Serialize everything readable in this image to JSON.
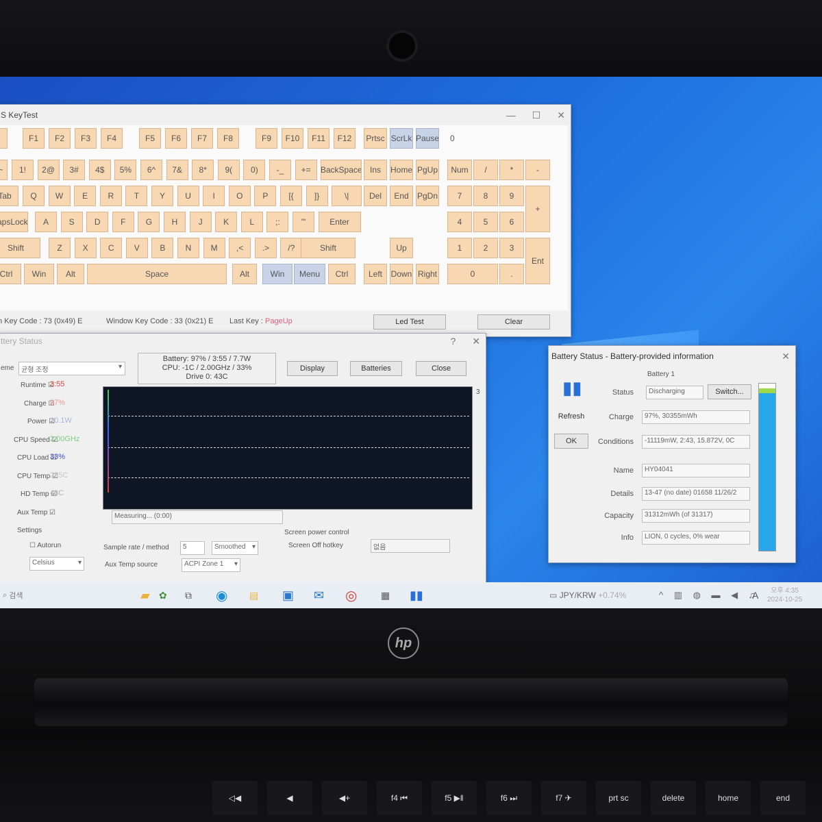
{
  "keytest": {
    "title": "S KeyTest",
    "counter": "0",
    "fn_row": [
      "F1",
      "F2",
      "F3",
      "F4",
      "F5",
      "F6",
      "F7",
      "F8",
      "F9",
      "F10",
      "F11",
      "F12"
    ],
    "sys_keys": [
      "Prtsc",
      "ScrLk",
      "Pause"
    ],
    "num_row": [
      "1!",
      "2@",
      "3#",
      "4$",
      "5%",
      "6^",
      "7&",
      "8*",
      "9(",
      "0)",
      "-_",
      "+=",
      "BackSpace"
    ],
    "q_row": [
      "Tab",
      "Q",
      "W",
      "E",
      "R",
      "T",
      "Y",
      "U",
      "I",
      "O",
      "P",
      "[{",
      "]}",
      "\\|"
    ],
    "a_row": [
      "CapsLock",
      "A",
      "S",
      "D",
      "F",
      "G",
      "H",
      "J",
      "K",
      "L",
      ";:",
      "'\"",
      "Enter"
    ],
    "z_row": [
      "Shift",
      "Z",
      "X",
      "C",
      "V",
      "B",
      "N",
      "M",
      ",<",
      ".>",
      "/?",
      "Shift"
    ],
    "bottom_row": [
      "Ctrl",
      "Win",
      "Alt",
      "Space",
      "Alt",
      "Win",
      "Menu",
      "Ctrl"
    ],
    "nav_top": [
      "Ins",
      "Home",
      "PgUp"
    ],
    "nav_mid": [
      "Del",
      "End",
      "PgDn"
    ],
    "arrows": [
      "Up",
      "Left",
      "Down",
      "Right"
    ],
    "numpad": [
      "Num",
      "/",
      "*",
      "-",
      "7",
      "8",
      "9",
      "+",
      "4",
      "5",
      "6",
      "1",
      "2",
      "3",
      "Ent",
      "0",
      "."
    ],
    "status": {
      "scan_code": "n Key Code : 73 (0x49) E",
      "window_code": "Window Key Code : 33 (0x21) E",
      "last_key_label": "Last Key :",
      "last_key_value": "PageUp"
    },
    "led_test": "Led Test",
    "clear": "Clear"
  },
  "battery_graph": {
    "title": "ttery Status",
    "scheme_label": "eme",
    "scheme_value": "균형 조정",
    "info_line1": "Battery: 97% / 3:55 / 7.7W",
    "info_line2": "CPU: -1C / 2.00GHz / 33%",
    "info_line3": "Drive 0: 43C",
    "display_btn": "Display",
    "batteries_btn": "Batteries",
    "close_btn": "Close",
    "metrics": [
      {
        "label": "Runtime",
        "value": "3:55",
        "color": "#e0463c"
      },
      {
        "label": "Charge",
        "value": "97%",
        "color": "#e89a8a"
      },
      {
        "label": "Power",
        "value": "10.1W",
        "color": "#a7b4dc"
      },
      {
        "label": "CPU Speed",
        "value": "2.00GHz",
        "color": "#7bd07b"
      },
      {
        "label": "CPU Load",
        "value": "33%",
        "color": "#3b4fd0"
      },
      {
        "label": "CPU Temp",
        "value": "255C",
        "color": "#c8c8c8"
      },
      {
        "label": "HD Temp",
        "value": "43C",
        "color": "#b0b0b0"
      },
      {
        "label": "Aux Temp",
        "value": "",
        "color": "#999"
      }
    ],
    "measuring": "Measuring... (0:00)",
    "settings_label": "Settings",
    "autorun": "Autorun",
    "units": "Celsius",
    "sample_label": "Sample rate / method",
    "sample_value": "5",
    "method_value": "Smoothed",
    "aux_label": "Aux Temp source",
    "aux_value": "ACPI Zone 1",
    "screen_ctrl": "Screen power control",
    "screen_hotkey": "Screen Off hotkey",
    "hotkey_value": "없음",
    "graph_corner": "3"
  },
  "battery_status": {
    "title": "Battery Status - Battery-provided information",
    "battery_label": "Battery 1",
    "refresh": "Refresh",
    "ok": "OK",
    "switch": "Switch...",
    "rows": [
      {
        "label": "Status",
        "value": "Discharging"
      },
      {
        "label": "Charge",
        "value": "97%, 30355mWh"
      },
      {
        "label": "Conditions",
        "value": "-11119mW, 2:43, 15.872V, 0C"
      },
      {
        "label": "Name",
        "value": "HY04041"
      },
      {
        "label": "Details",
        "value": "13-47 (no date) 01658 11/26/2"
      },
      {
        "label": "Capacity",
        "value": "31312mWh (of 31317)"
      },
      {
        "label": "Info",
        "value": "LION, 0 cycles, 0% wear"
      }
    ]
  },
  "taskbar": {
    "search_text": "검색",
    "currency": "JPY/KRW",
    "currency_change": "+0.74%",
    "ime": "A",
    "time": "오후 4:35",
    "date": "2024-10-25"
  },
  "laptop": {
    "brand": "hp",
    "keys": [
      "◁◀",
      "◀",
      "◀+",
      "f4 ⏮",
      "f5 ▶‖",
      "f6 ⏭",
      "f7 ✈",
      "prt sc",
      "delete",
      "home",
      "end"
    ]
  }
}
